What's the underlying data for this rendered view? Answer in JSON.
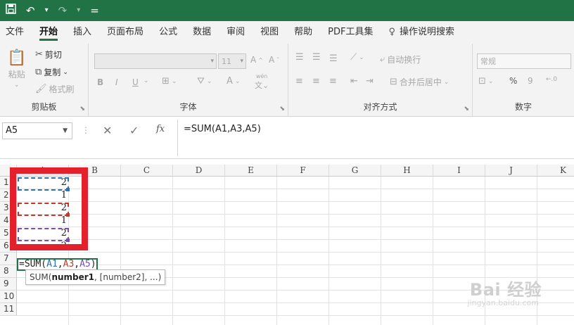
{
  "quick_access": {
    "save_icon": "save-icon",
    "undo_icon": "undo-icon",
    "redo_icon": "redo-icon",
    "customize_glyph": "="
  },
  "tabs": [
    {
      "label": "文件"
    },
    {
      "label": "开始"
    },
    {
      "label": "插入"
    },
    {
      "label": "页面布局"
    },
    {
      "label": "公式"
    },
    {
      "label": "数据"
    },
    {
      "label": "审阅"
    },
    {
      "label": "视图"
    },
    {
      "label": "帮助"
    },
    {
      "label": "PDF工具集"
    },
    {
      "label": "操作说明搜索"
    }
  ],
  "active_tab": "开始",
  "ribbon": {
    "clipboard": {
      "paste": "粘贴",
      "cut": "剪切",
      "copy": "复制",
      "format_painter": "格式刷",
      "group_label": "剪贴板"
    },
    "font": {
      "size": "11",
      "bold": "B",
      "italic": "I",
      "underline": "U",
      "wen": "wén",
      "group_label": "字体"
    },
    "alignment": {
      "wrap_text": "自动换行",
      "merge_center": "合并后居中",
      "group_label": "对齐方式"
    },
    "number": {
      "format": "常规",
      "percent": "%",
      "comma": "9",
      "group_label": "数字"
    }
  },
  "formula_bar": {
    "name_box": "A5",
    "fx": "fx",
    "formula": "=SUM(A1,A3,A5)"
  },
  "columns": [
    "A",
    "B",
    "C",
    "D",
    "E",
    "F",
    "G",
    "H",
    "I",
    "J",
    "K"
  ],
  "rows": [
    "1",
    "2",
    "3",
    "4",
    "5",
    "6",
    "7",
    "8",
    "9",
    "10",
    "11"
  ],
  "cells": {
    "A1": "2",
    "A2": "1",
    "A3": "2",
    "A4": "1",
    "A5": "2",
    "A6": "2"
  },
  "edit_cell": {
    "prefix": "=SUM(",
    "ref1": "A1",
    "sep1": ",",
    "ref2": "A3",
    "sep2": ",",
    "ref3": "A5",
    "suffix": ")"
  },
  "tooltip": {
    "func": "SUM(",
    "arg1": "number1",
    "rest": ", [number2], ...)"
  },
  "colors": {
    "excel_green": "#217346",
    "highlight_red": "#e3202b",
    "ref_blue": "#2f6fb8",
    "ref_red": "#c0392b",
    "ref_purple": "#7b4fa8"
  },
  "watermark": {
    "logo": "Bai 经验",
    "url": "jingyan.baidu.com"
  }
}
